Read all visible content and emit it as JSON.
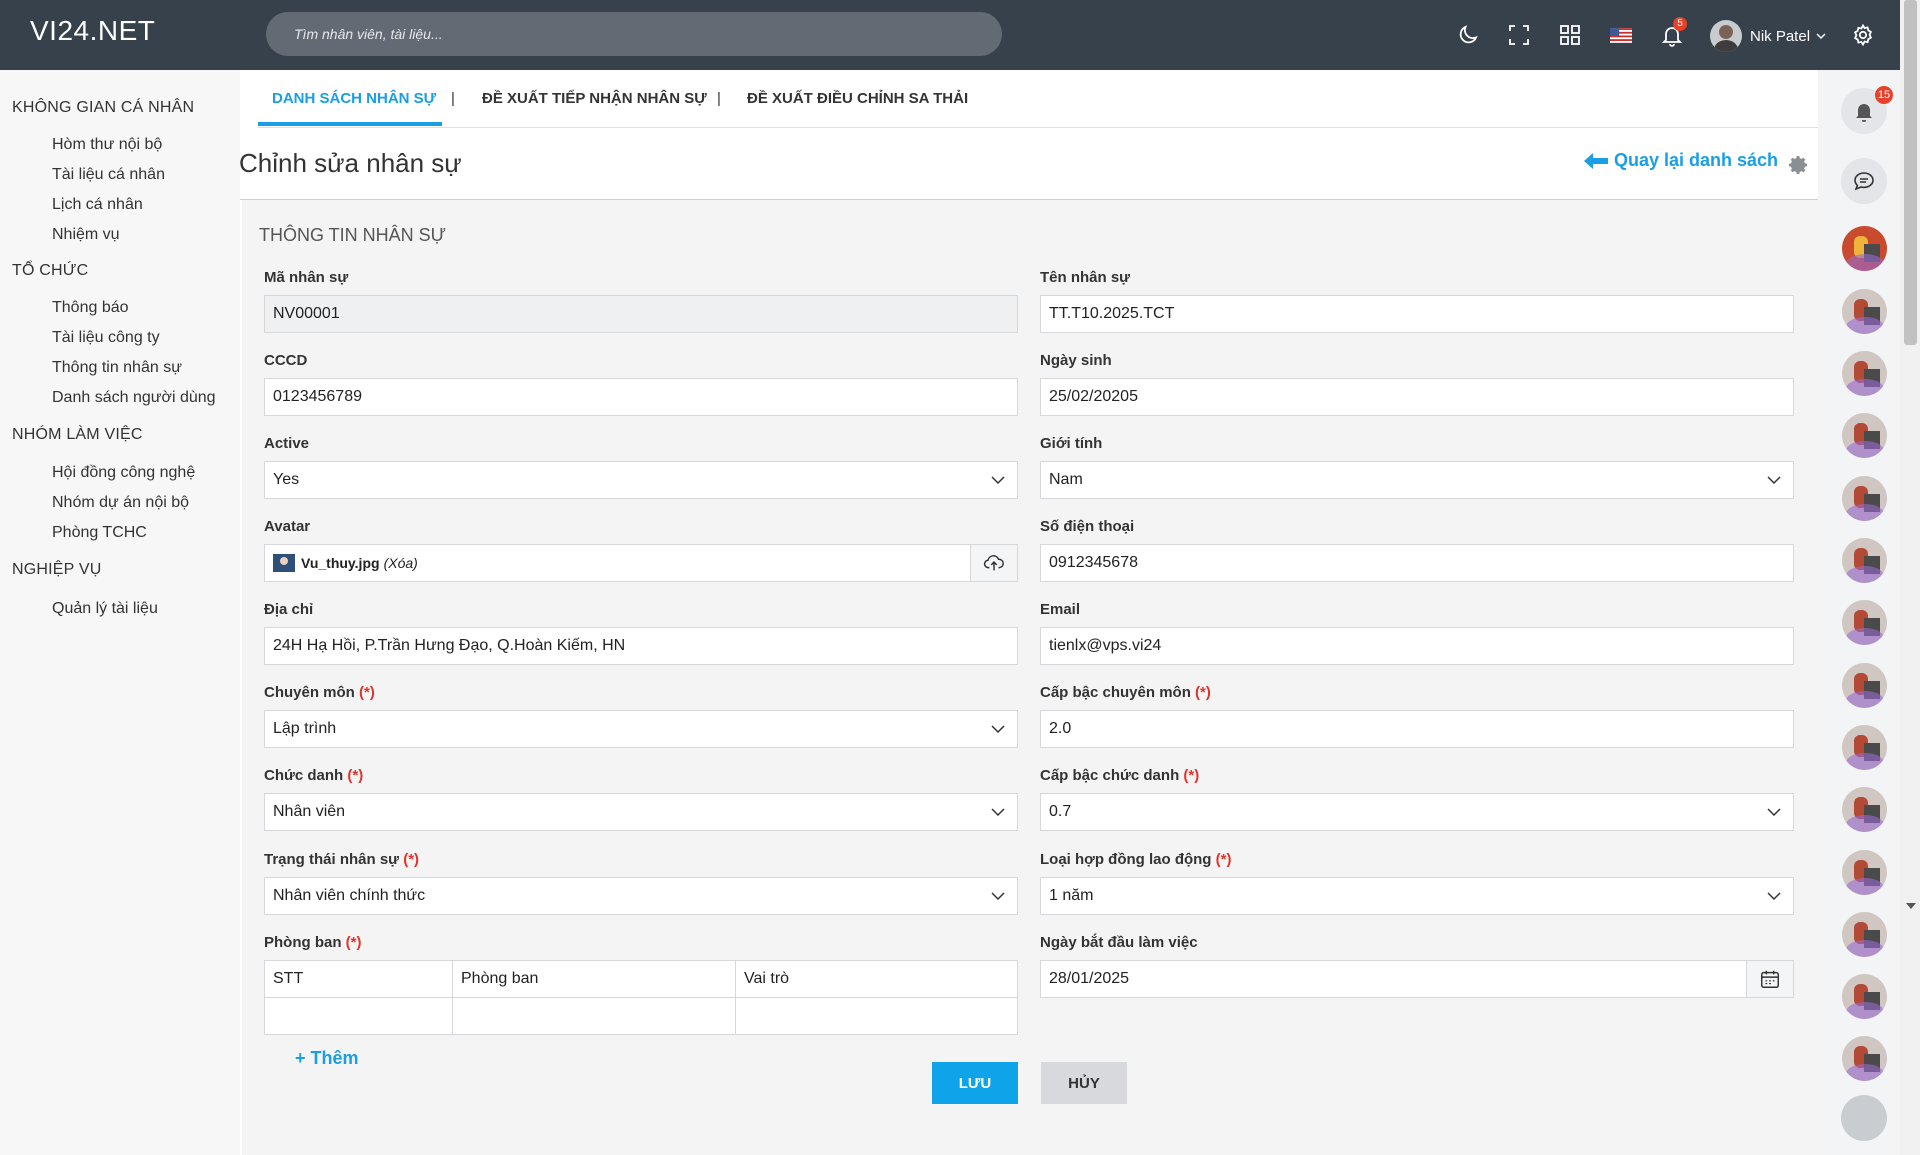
{
  "app": {
    "logo": "VI24.NET",
    "search_placeholder": "Tìm nhân viên, tài liệu...",
    "notifications_count": "5",
    "user_name": "Nik Patel"
  },
  "sidebar": {
    "sections": [
      {
        "title": "KHÔNG GIAN CÁ NHÂN",
        "items": [
          "Hòm thư nội bộ",
          "Tài liệu cá nhân",
          "Lịch cá nhân",
          "Nhiệm vụ"
        ]
      },
      {
        "title": "TỔ CHỨC",
        "items": [
          "Thông báo",
          "Tài liệu công ty",
          "Thông tin nhân sự",
          "Danh sách người dùng"
        ]
      },
      {
        "title": "NHÓM LÀM VIỆC",
        "items": [
          "Hội đồng công nghệ",
          "Nhóm dự án nội bộ",
          "Phòng TCHC"
        ]
      },
      {
        "title": "NGHIỆP VỤ",
        "items": [
          "Quản lý tài liệu"
        ]
      }
    ]
  },
  "tabs": {
    "t1": "DANH SÁCH NHÂN SỰ",
    "t2": "ĐỀ XUẤT TIẾP NHẬN NHÂN SỰ",
    "t3": "ĐỀ XUẤT ĐIỀU CHỈNH SA THẢI",
    "sep": "|"
  },
  "page": {
    "title": "Chỉnh sửa nhân sự",
    "back_label": "Quay lại danh sách",
    "section_title": "THÔNG TIN NHÂN SỰ",
    "required_mark": "(*)"
  },
  "form": {
    "ma_label": "Mã nhân sự",
    "ma_value": "NV00001",
    "ten_label": "Tên nhân sự",
    "ten_value": "TT.T10.2025.TCT",
    "cccd_label": "CCCD",
    "cccd_value": "0123456789",
    "ngaysinh_label": "Ngày sinh",
    "ngaysinh_value": "25/02/20205",
    "active_label": "Active",
    "active_value": "Yes",
    "gioitinh_label": "Giới tính",
    "gioitinh_value": "Nam",
    "avatar_label": "Avatar",
    "avatar_file": "Vu_thuy.jpg",
    "avatar_delete": "(Xóa)",
    "sdt_label": "Số điện thoại",
    "sdt_value": "0912345678",
    "diachi_label": "Địa chỉ",
    "diachi_value": "24H Hạ Hồi, P.Trần Hưng Đạo, Q.Hoàn Kiếm, HN",
    "email_label": "Email",
    "email_value": "tienlx@vps.vi24",
    "chuyenmon_label": "Chuyên môn",
    "chuyenmon_value": "Lập trình",
    "capbaccm_label": "Cấp bậc chuyên môn",
    "capbaccm_value": "2.0",
    "chucdanh_label": "Chức danh",
    "chucdanh_value": "Nhân viên",
    "capbaccd_label": "Cấp bậc chức danh",
    "capbaccd_value": "0.7",
    "trangthai_label": "Trạng thái nhân sự",
    "trangthai_value": "Nhân viên chính thức",
    "hopdong_label": "Loại hợp đồng lao động",
    "hopdong_value": "1 năm",
    "phongban_label": "Phòng ban",
    "ngaybd_label": "Ngày bắt đầu làm việc",
    "ngaybd_value": "28/01/2025",
    "table_headers": [
      "STT",
      "Phòng ban",
      "Vai trò"
    ],
    "add_label": "+ Thêm",
    "save_label": "LƯU",
    "cancel_label": "HỦY"
  },
  "rail": {
    "notifications_count": "15"
  },
  "colors": {
    "accent": "#1a9ee6",
    "topbar": "#36414b",
    "required": "#e0332a"
  }
}
